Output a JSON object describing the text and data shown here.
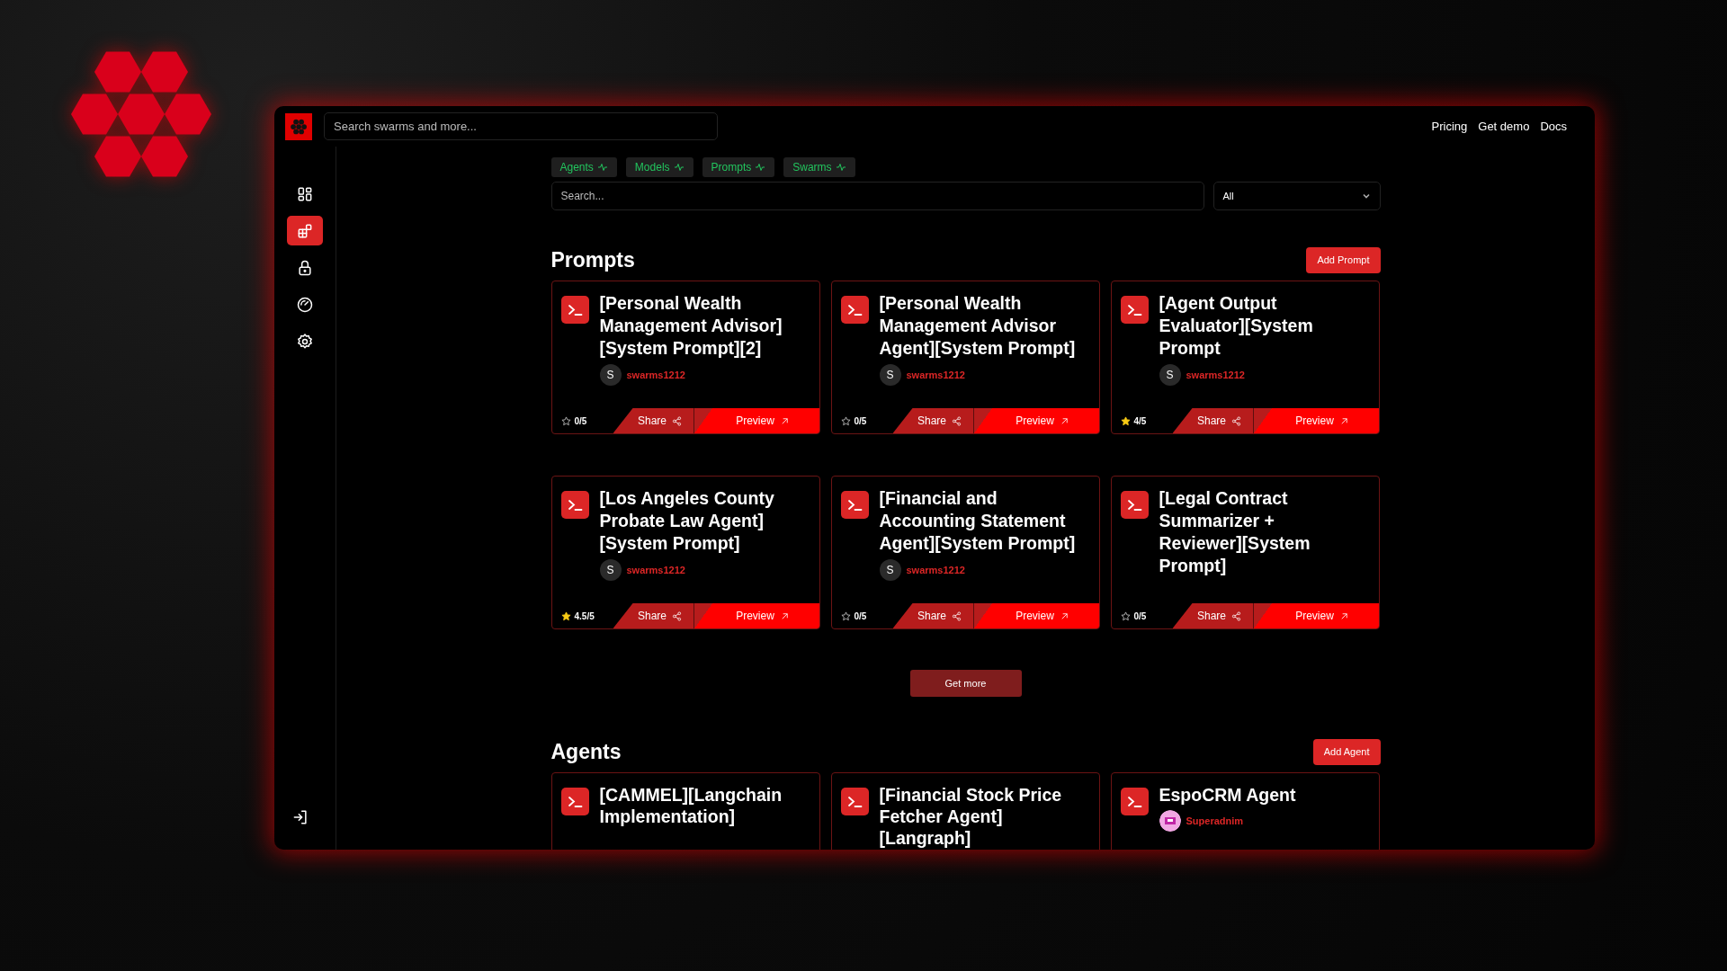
{
  "header": {
    "search_placeholder": "Search swarms and more...",
    "links": [
      "Pricing",
      "Get demo",
      "Docs"
    ]
  },
  "sidebar": {
    "items": [
      {
        "selected": false
      },
      {
        "selected": true
      },
      {
        "selected": false
      },
      {
        "selected": false
      },
      {
        "selected": false
      }
    ]
  },
  "tags": [
    "Agents",
    "Models",
    "Prompts",
    "Swarms"
  ],
  "filter": {
    "search_placeholder": "Search...",
    "category": "All"
  },
  "sections": [
    {
      "title": "Prompts",
      "add_button": "Add Prompt",
      "more_button": "Get more",
      "cards": [
        {
          "title": "[Personal Wealth Management Advisor][System Prompt][2]",
          "author_initial": "S",
          "author": "swarms1212",
          "rating": "0/5",
          "starred": false,
          "share": "Share",
          "preview": "Preview"
        },
        {
          "title": "[Personal Wealth Management Advisor Agent][System Prompt]",
          "author_initial": "S",
          "author": "swarms1212",
          "rating": "0/5",
          "starred": false,
          "share": "Share",
          "preview": "Preview"
        },
        {
          "title": "[Agent Output Evaluator][System Prompt",
          "author_initial": "S",
          "author": "swarms1212",
          "rating": "4/5",
          "starred": true,
          "share": "Share",
          "preview": "Preview"
        },
        {
          "title": "[Los Angeles County Probate Law Agent][System Prompt]",
          "author_initial": "S",
          "author": "swarms1212",
          "rating": "4.5/5",
          "starred": true,
          "share": "Share",
          "preview": "Preview"
        },
        {
          "title": "[Financial and Accounting Statement Agent][System Prompt]",
          "author_initial": "S",
          "author": "swarms1212",
          "rating": "0/5",
          "starred": false,
          "share": "Share",
          "preview": "Preview"
        },
        {
          "title": "[Legal Contract Summarizer + Reviewer][System Prompt]",
          "rating": "0/5",
          "starred": false,
          "share": "Share",
          "preview": "Preview"
        }
      ]
    },
    {
      "title": "Agents",
      "add_button": "Add Agent",
      "cards": [
        {
          "title": "[CAMMEL][Langchain Implementation]"
        },
        {
          "title": "[Financial Stock Price Fetcher Agent][Langraph]"
        },
        {
          "title": "EspoCRM Agent",
          "author": "Superadnim"
        }
      ]
    }
  ]
}
